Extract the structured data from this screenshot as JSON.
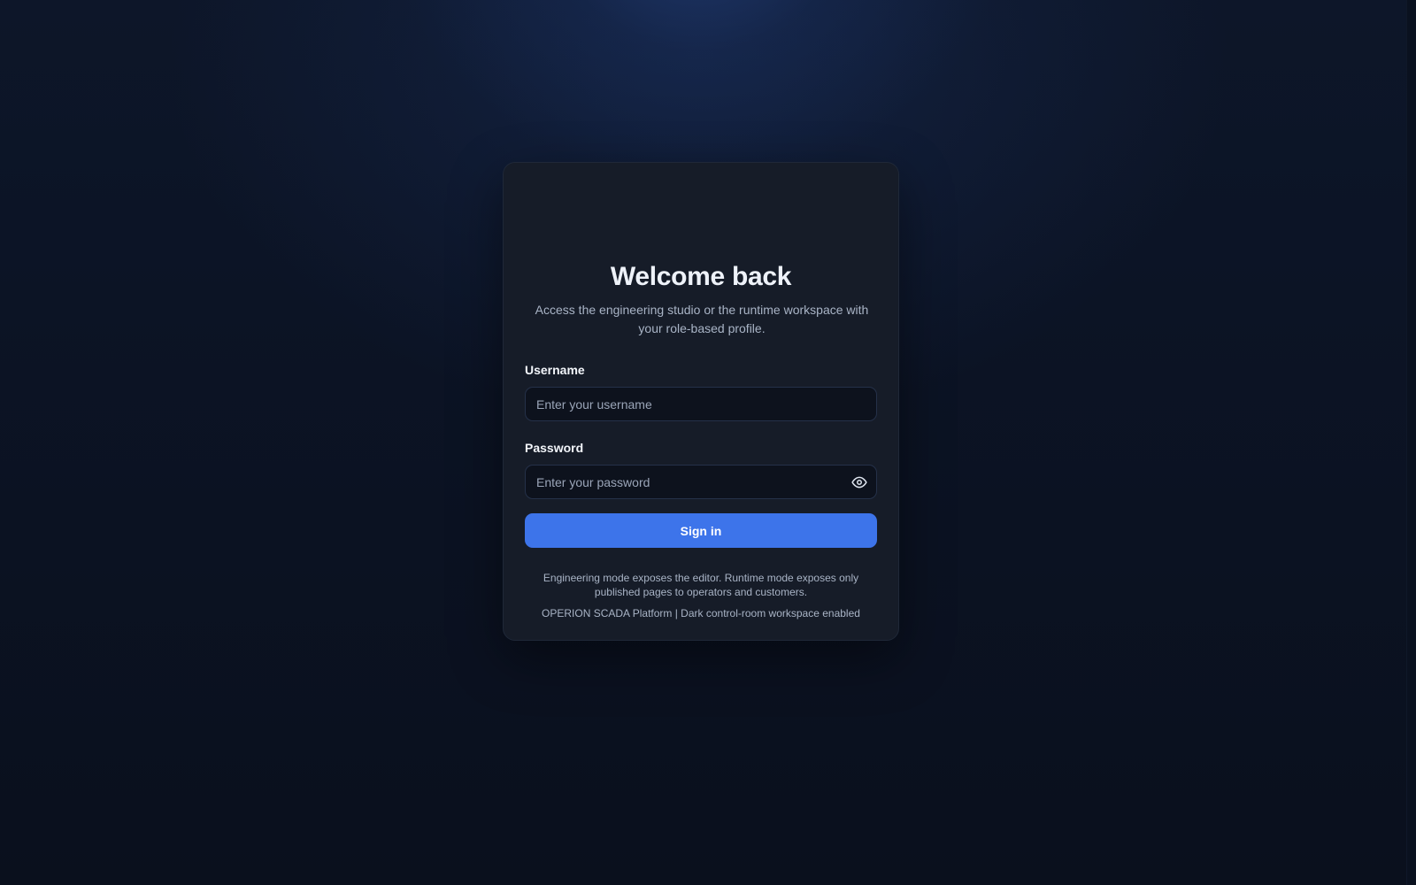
{
  "login": {
    "title": "Welcome back",
    "subtitle": "Access the engineering studio or the runtime workspace with your role-based profile.",
    "username": {
      "label": "Username",
      "placeholder": "Enter your username",
      "value": ""
    },
    "password": {
      "label": "Password",
      "placeholder": "Enter your password",
      "value": "",
      "toggle_icon": "eye-icon"
    },
    "submit_label": "Sign in",
    "note": "Engineering mode exposes the editor. Runtime mode exposes only published pages to operators and customers.",
    "footer": "OPERION SCADA Platform | Dark control-room workspace enabled"
  },
  "colors": {
    "background": "#0b1222",
    "card": "#161c28",
    "input": "#0d121d",
    "accent": "#3d74ea",
    "text_primary": "#eef2f9",
    "text_muted": "#a9b4c6"
  }
}
